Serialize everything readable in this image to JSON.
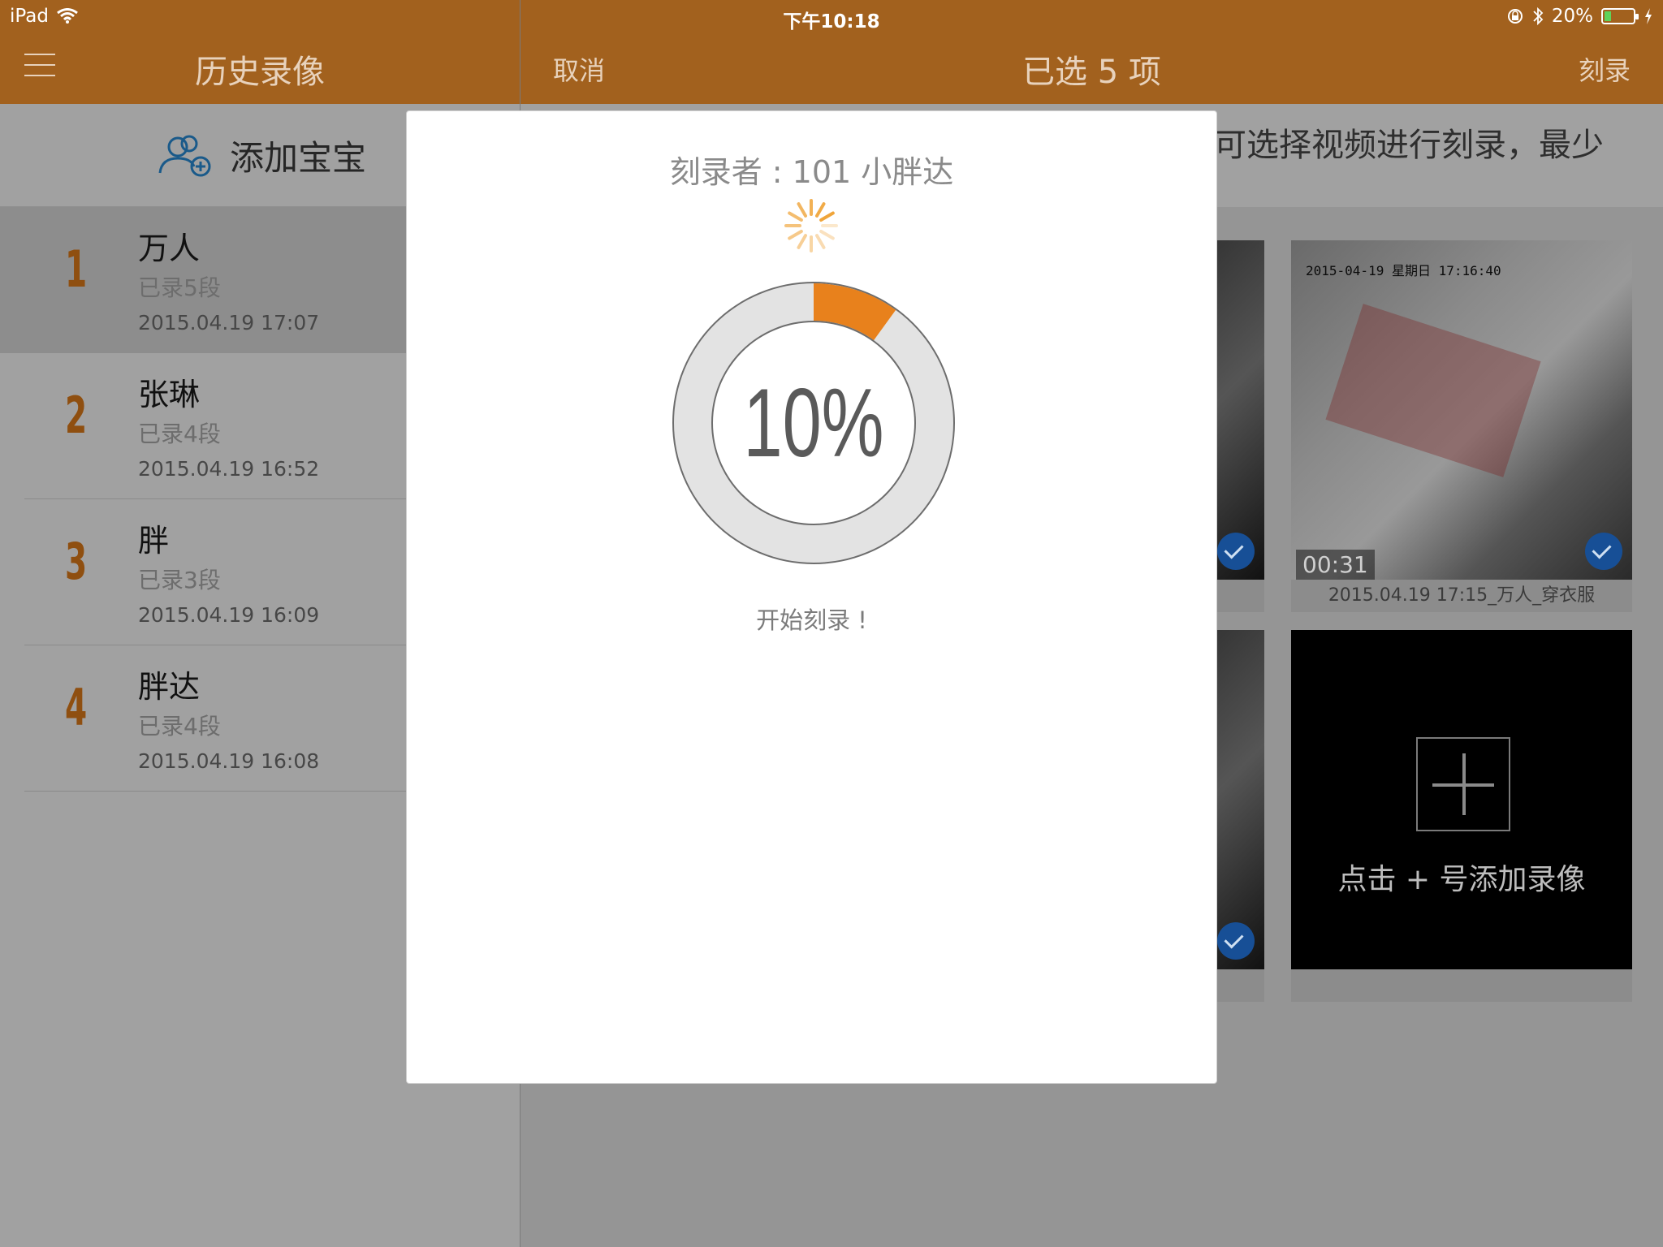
{
  "status_bar": {
    "device": "iPad",
    "time": "下午10:18",
    "battery": "20%",
    "icons": [
      "wifi-icon",
      "rotation-lock-icon",
      "bluetooth-icon",
      "battery-icon",
      "charging-icon"
    ]
  },
  "left_nav": {
    "title": "历史录像",
    "menu_icon": "hamburger-icon"
  },
  "right_nav": {
    "cancel": "取消",
    "title": "已选 5 项",
    "burn": "刻录"
  },
  "sidebar": {
    "add_baby": "添加宝宝",
    "items": [
      {
        "num": "1",
        "name": "万人",
        "count": "已录5段",
        "date": "2015.04.19 17:07",
        "selected": true
      },
      {
        "num": "2",
        "name": "张琳",
        "count": "已录4段",
        "date": "2015.04.19 16:52",
        "selected": false
      },
      {
        "num": "3",
        "name": "胖",
        "count": "已录3段",
        "date": "2015.04.19 16:09",
        "selected": false
      },
      {
        "num": "4",
        "name": "胖达",
        "count": "已录4段",
        "date": "2015.04.19 16:08",
        "selected": false
      }
    ]
  },
  "main": {
    "hint": "可选择视频进行刻录，最少",
    "video": {
      "stamp": "2015-04-19 星期日 17:16:40",
      "duration": "00:31",
      "caption": "2015.04.19 17:15_万人_穿衣服"
    },
    "add_video_label": "点击 + 号添加录像"
  },
  "modal": {
    "burner": "刻录者 : 101    小胖达",
    "progress": 0.1,
    "percent_text": "10%",
    "start_text": "开始刻录 !",
    "colors": {
      "progress": "#e8811c",
      "track": "#e3e3e3",
      "border": "#6d6d6d"
    }
  }
}
